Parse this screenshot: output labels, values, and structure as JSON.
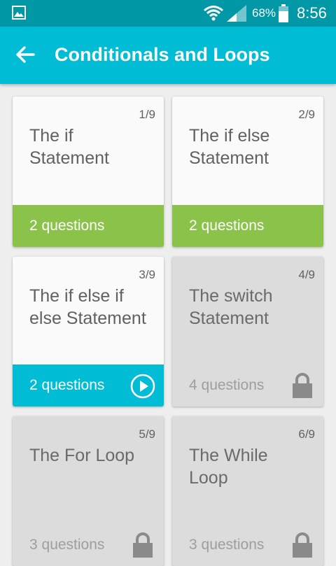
{
  "status_bar": {
    "battery_percent": "68%",
    "time": "8:56",
    "icons": [
      "gallery-icon",
      "wifi-icon",
      "signal-icon",
      "battery-icon"
    ]
  },
  "app_bar": {
    "title": "Conditionals and Loops",
    "back_icon": "arrow-back-icon"
  },
  "colors": {
    "status_bar": "#0097a7",
    "app_bar": "#00bcd4",
    "done": "#8bc34a",
    "current": "#00bcd4",
    "locked": "#dcdcdc"
  },
  "lessons": [
    {
      "counter": "1/9",
      "title": "The if Statement",
      "questions": "2 questions",
      "state": "done"
    },
    {
      "counter": "2/9",
      "title": "The if else Statement",
      "questions": "2 questions",
      "state": "done"
    },
    {
      "counter": "3/9",
      "title": "The if else if else Statement",
      "questions": "2 questions",
      "state": "current",
      "icon": "play-circle-icon"
    },
    {
      "counter": "4/9",
      "title": "The switch Statement",
      "questions": "4 questions",
      "state": "locked",
      "icon": "lock-icon"
    },
    {
      "counter": "5/9",
      "title": "The For Loop",
      "questions": "3 questions",
      "state": "locked",
      "icon": "lock-icon"
    },
    {
      "counter": "6/9",
      "title": "The While Loop",
      "questions": "3 questions",
      "state": "locked",
      "icon": "lock-icon"
    }
  ]
}
